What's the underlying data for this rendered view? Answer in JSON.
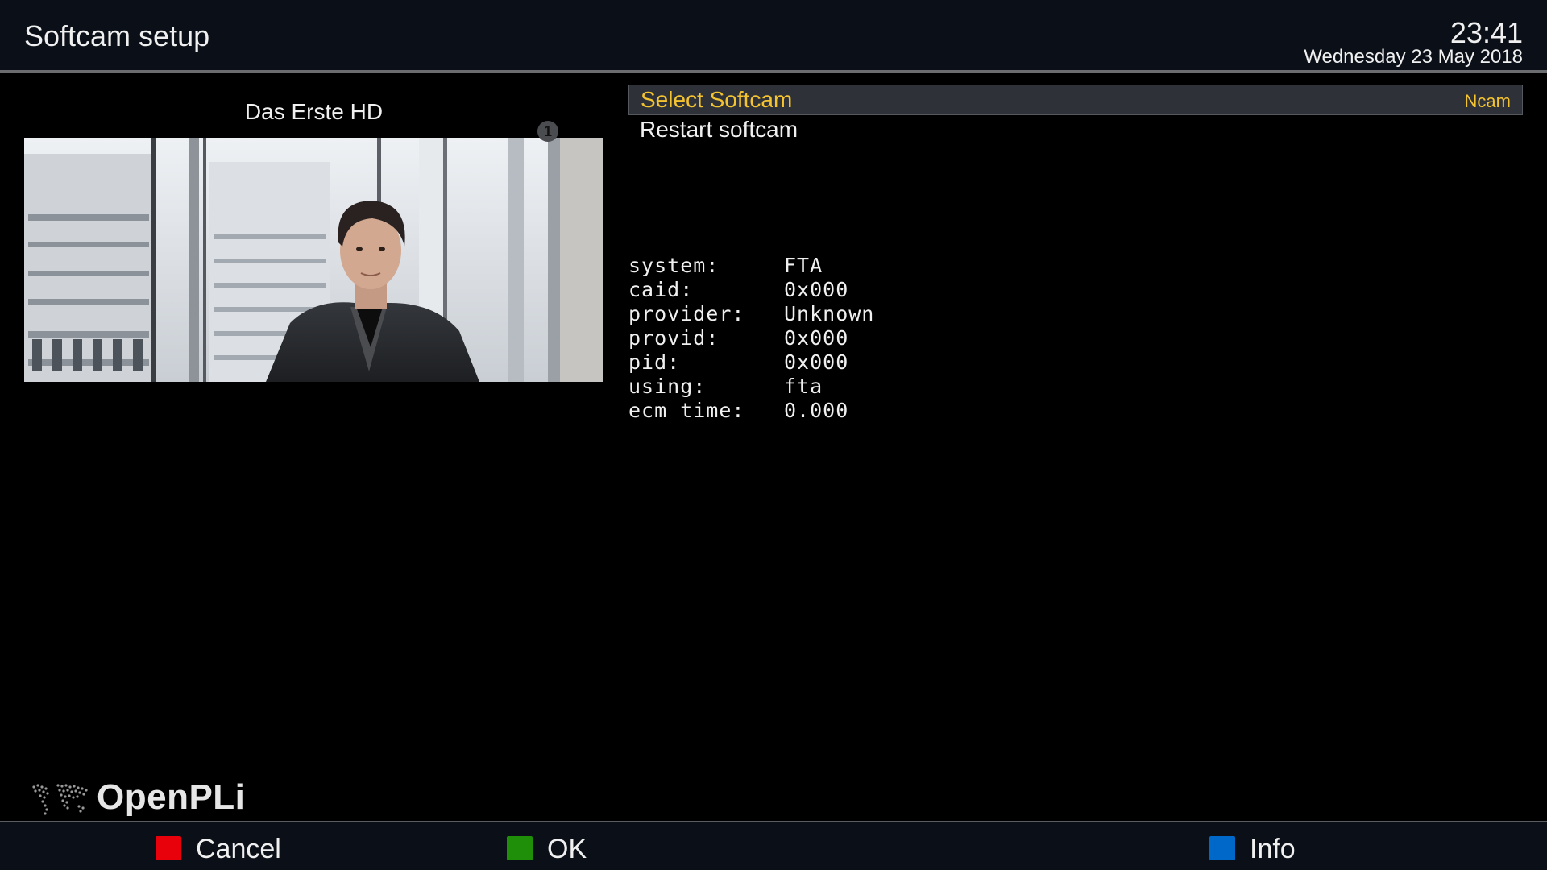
{
  "header": {
    "title": "Softcam setup",
    "time": "23:41",
    "date": "Wednesday 23 May 2018"
  },
  "preview": {
    "channel_name": "Das Erste HD",
    "channel_logo_text": "1",
    "channel_logo_icon": "das-erste-logo-icon"
  },
  "menu": {
    "items": [
      {
        "label": "Select Softcam",
        "value": "Ncam",
        "selected": true
      },
      {
        "label": "Restart softcam",
        "value": "",
        "selected": false
      }
    ]
  },
  "info": {
    "rows": [
      {
        "key": "system:",
        "value": "FTA"
      },
      {
        "key": "caid:",
        "value": "0x000"
      },
      {
        "key": "provider:",
        "value": "Unknown"
      },
      {
        "key": "provid:",
        "value": "0x000"
      },
      {
        "key": "pid:",
        "value": "0x000"
      },
      {
        "key": "using:",
        "value": "fta"
      },
      {
        "key": "ecm time:",
        "value": "0.000"
      }
    ]
  },
  "branding": {
    "logo_text": "OpenPLi"
  },
  "footer": {
    "cancel_label": "Cancel",
    "ok_label": "OK",
    "info_label": "Info"
  },
  "colors": {
    "highlight": "#f4c430",
    "red_key": "#e8000b",
    "green_key": "#1f8f0a",
    "blue_key": "#0068c8"
  }
}
